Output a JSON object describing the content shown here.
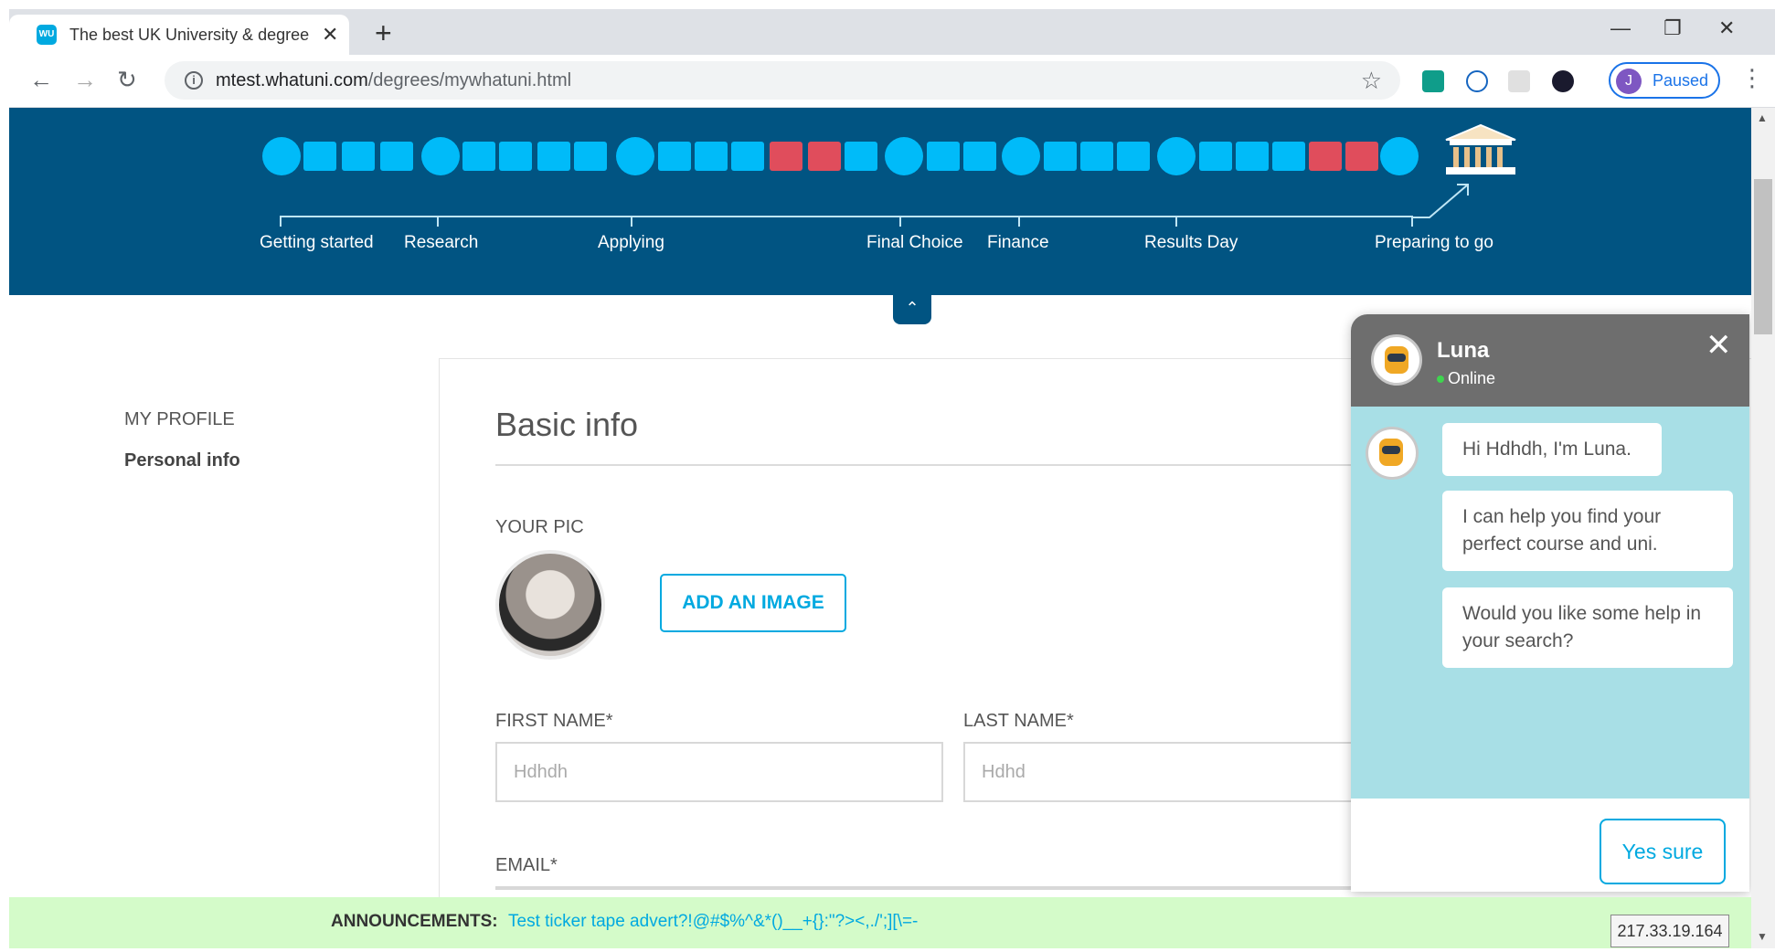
{
  "browser": {
    "tab_title": "The best UK University & degree",
    "favicon_text": "WU",
    "url_domain": "mtest.whatuni.com",
    "url_path": "/degrees/mywhatuni.html",
    "profile_initial": "J",
    "profile_status": "Paused"
  },
  "progress": {
    "stages": [
      "Getting started",
      "Research",
      "Applying",
      "Final Choice",
      "Finance",
      "Results Day",
      "Preparing to go"
    ],
    "colors": {
      "done": "#00bbf9",
      "flagged": "#e04d5c",
      "band": "#015482"
    }
  },
  "sidebar": {
    "title": "MY PROFILE",
    "items": [
      "Personal info"
    ]
  },
  "form": {
    "title": "Basic info",
    "pic_label": "YOUR PIC",
    "add_image_label": "ADD AN IMAGE",
    "first_name_label": "FIRST NAME*",
    "first_name_value": "Hdhdh",
    "last_name_label": "LAST NAME*",
    "last_name_value": "Hdhd",
    "email_label": "EMAIL*"
  },
  "chat": {
    "bot_name": "Luna",
    "status": "Online",
    "messages": [
      "Hi Hdhdh, I'm Luna.",
      "I can help you find your perfect course and uni.",
      "Would you like some help in your search?"
    ],
    "reply_label": "Yes sure"
  },
  "announcement": {
    "label": "ANNOUNCEMENTS:",
    "text": "Test ticker tape advert?!@#$%^&*()__+{}:\"?><,./';][\\=-"
  },
  "ip_address": "217.33.19.164"
}
